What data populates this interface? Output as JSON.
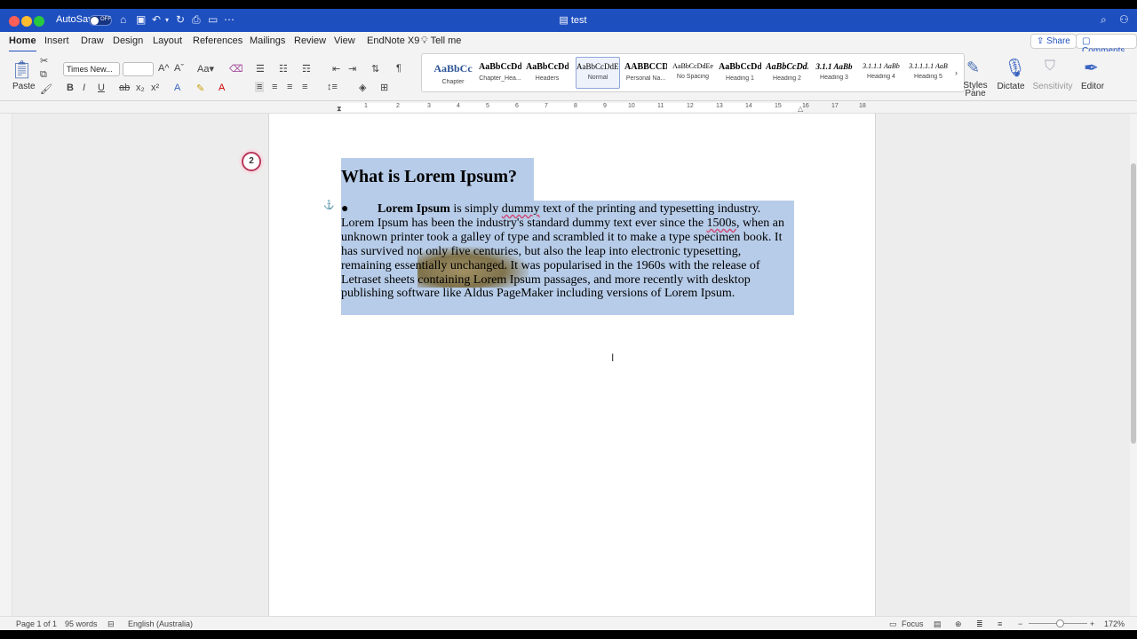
{
  "window": {
    "doc_title": "test",
    "autosave_label": "AutoSave",
    "autosave_state": "OFF"
  },
  "tabs": [
    "Home",
    "Insert",
    "Draw",
    "Design",
    "Layout",
    "References",
    "Mailings",
    "Review",
    "View",
    "EndNote X9"
  ],
  "tell_me": "Tell me",
  "share_label": "Share",
  "comments_label": "Comments",
  "ribbon": {
    "paste": "Paste",
    "font_name": "Times New...",
    "font_size": "",
    "styles": [
      {
        "preview": "AaBbCc",
        "name": "Chapter"
      },
      {
        "preview": "AaBbCcDdE",
        "name": "Chapter_Hea..."
      },
      {
        "preview": "AaBbCcDdE",
        "name": "Headers"
      },
      {
        "preview": "AaBbCcDdEe",
        "name": "Normal"
      },
      {
        "preview": "AABBCCD",
        "name": "Personal Na..."
      },
      {
        "preview": "AaBbCcDdEe",
        "name": "No Spacing"
      },
      {
        "preview": "AaBbCcDdE",
        "name": "Heading 1"
      },
      {
        "preview": "AaBbCcDdE",
        "name": "Heading 2"
      },
      {
        "preview": "3.1.1 AaBb",
        "name": "Heading 3"
      },
      {
        "preview": "3.1.1.1 AaBb",
        "name": "Heading 4"
      },
      {
        "preview": "3.1.1.1.1 AaB",
        "name": "Heading 5"
      }
    ],
    "styles_pane": "Styles Pane",
    "dictate": "Dictate",
    "sensitivity": "Sensitivity",
    "editor": "Editor"
  },
  "ruler_ticks": [
    "1",
    "2",
    "3",
    "4",
    "5",
    "6",
    "7",
    "8",
    "9",
    "10",
    "11",
    "12",
    "13",
    "14",
    "15",
    "16",
    "17",
    "18"
  ],
  "document": {
    "heading": "What is Lorem Ipsum?",
    "bold_lead": "Lorem Ipsum",
    "text_a": " is simply ",
    "err1": "dummy",
    "text_b": " text of the printing and typesetting industry. Lorem Ipsum has been the industry's standard dummy text ever since the ",
    "err2": "1500s",
    "text_c": ", when an unknown printer took a galley of type and scrambled it to make a type specimen book. It has survived not only five centuries, but also the leap into electronic typesetting, remaining essentially unchanged. It was popularised in the 1960s with the release of Letraset sheets containing Lorem Ipsum passages, and more recently with desktop publishing software like Aldus PageMaker including versions of Lorem Ipsum."
  },
  "badge": "2",
  "status": {
    "page": "Page 1 of 1",
    "words": "95 words",
    "language": "English (Australia)",
    "focus": "Focus",
    "zoom": "172%"
  }
}
